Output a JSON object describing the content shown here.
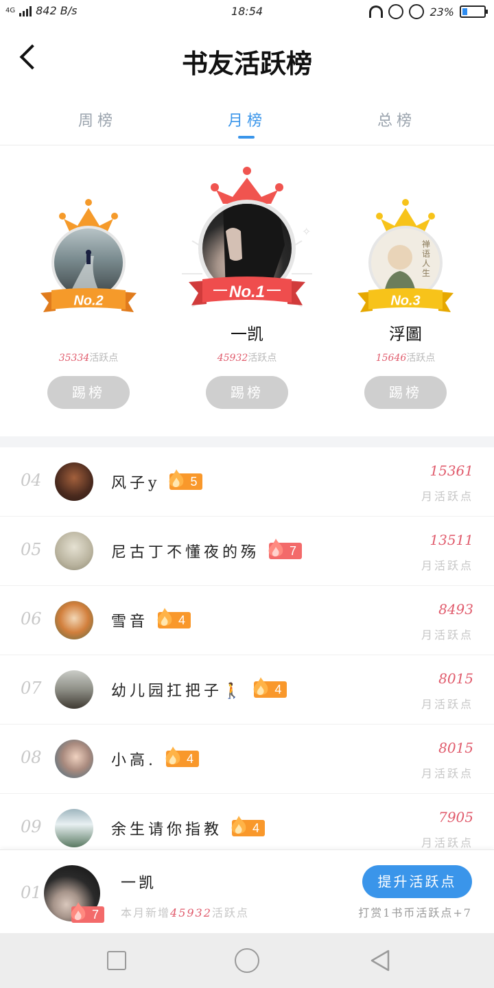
{
  "status_bar": {
    "network_type": "4G",
    "speed": "842 B/s",
    "time": "18:54",
    "battery": "23%",
    "battery_level": 0.23
  },
  "header": {
    "title": "书友活跃榜"
  },
  "tabs": [
    {
      "label": "周榜",
      "active": false
    },
    {
      "label": "月榜",
      "active": true
    },
    {
      "label": "总榜",
      "active": false
    }
  ],
  "podium": {
    "first": {
      "rank": "No.1",
      "name": "一凯",
      "points": "45932",
      "points_suffix": "活跃点",
      "kick_label": "踢榜"
    },
    "second": {
      "rank": "No.2",
      "name": "",
      "points": "35334",
      "points_suffix": "活跃点",
      "kick_label": "踢榜"
    },
    "third": {
      "rank": "No.3",
      "name": "浮圖",
      "points": "15646",
      "points_suffix": "活跃点",
      "kick_label": "踢榜",
      "avatar_text": "禅语人生"
    }
  },
  "list": [
    {
      "rank": "04",
      "name": "风子y",
      "level": "5",
      "badge_color": "orange",
      "points": "15361",
      "points_label": "月活跃点"
    },
    {
      "rank": "05",
      "name": "尼古丁不懂夜的殇",
      "level": "7",
      "badge_color": "red",
      "points": "13511",
      "points_label": "月活跃点"
    },
    {
      "rank": "06",
      "name": "雪音",
      "level": "4",
      "badge_color": "orange",
      "points": "8493",
      "points_label": "月活跃点"
    },
    {
      "rank": "07",
      "name": "幼儿园扛把子🚶",
      "level": "4",
      "badge_color": "orange",
      "points": "8015",
      "points_label": "月活跃点"
    },
    {
      "rank": "08",
      "name": "小高.",
      "level": "4",
      "badge_color": "orange",
      "points": "8015",
      "points_label": "月活跃点"
    },
    {
      "rank": "09",
      "name": "余生请你指教",
      "level": "4",
      "badge_color": "orange",
      "points": "7905",
      "points_label": "月活跃点"
    }
  ],
  "my_rank": {
    "rank": "01",
    "name": "一凯",
    "level": "7",
    "desc_prefix": "本月新增",
    "desc_points": "45932",
    "desc_suffix": "活跃点",
    "boost_label": "提升活跃点",
    "boost_note": "打赏1书币活跃点+7"
  },
  "colors": {
    "accent": "#3a95ea",
    "points_red": "#e05a6b",
    "badge_orange": "#f9982b",
    "badge_red": "#f36a6a",
    "gold_crown": "#f7c31a",
    "silver_crown": "#f59a2a",
    "first_crown": "#f0544f"
  },
  "icons": {
    "back": "chevron-left-icon",
    "fire": "flame-icon",
    "crown": "crown-icon",
    "nav_recent": "square-icon",
    "nav_home": "circle-icon",
    "nav_back": "triangle-back-icon"
  }
}
